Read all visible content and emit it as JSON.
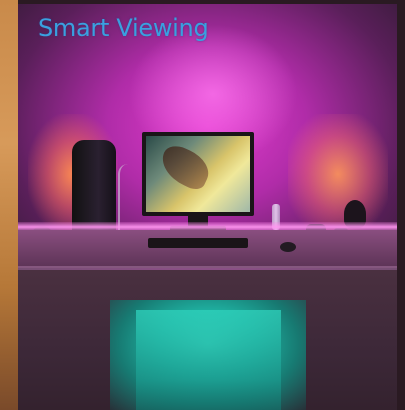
{
  "overlay": {
    "title": "Smart Viewing"
  },
  "colors": {
    "title_text": "#3aa0e0",
    "ambient_magenta": "#e23ccf",
    "ambient_orange": "#ff8c50",
    "cabinet_teal": "#3de0c8"
  }
}
